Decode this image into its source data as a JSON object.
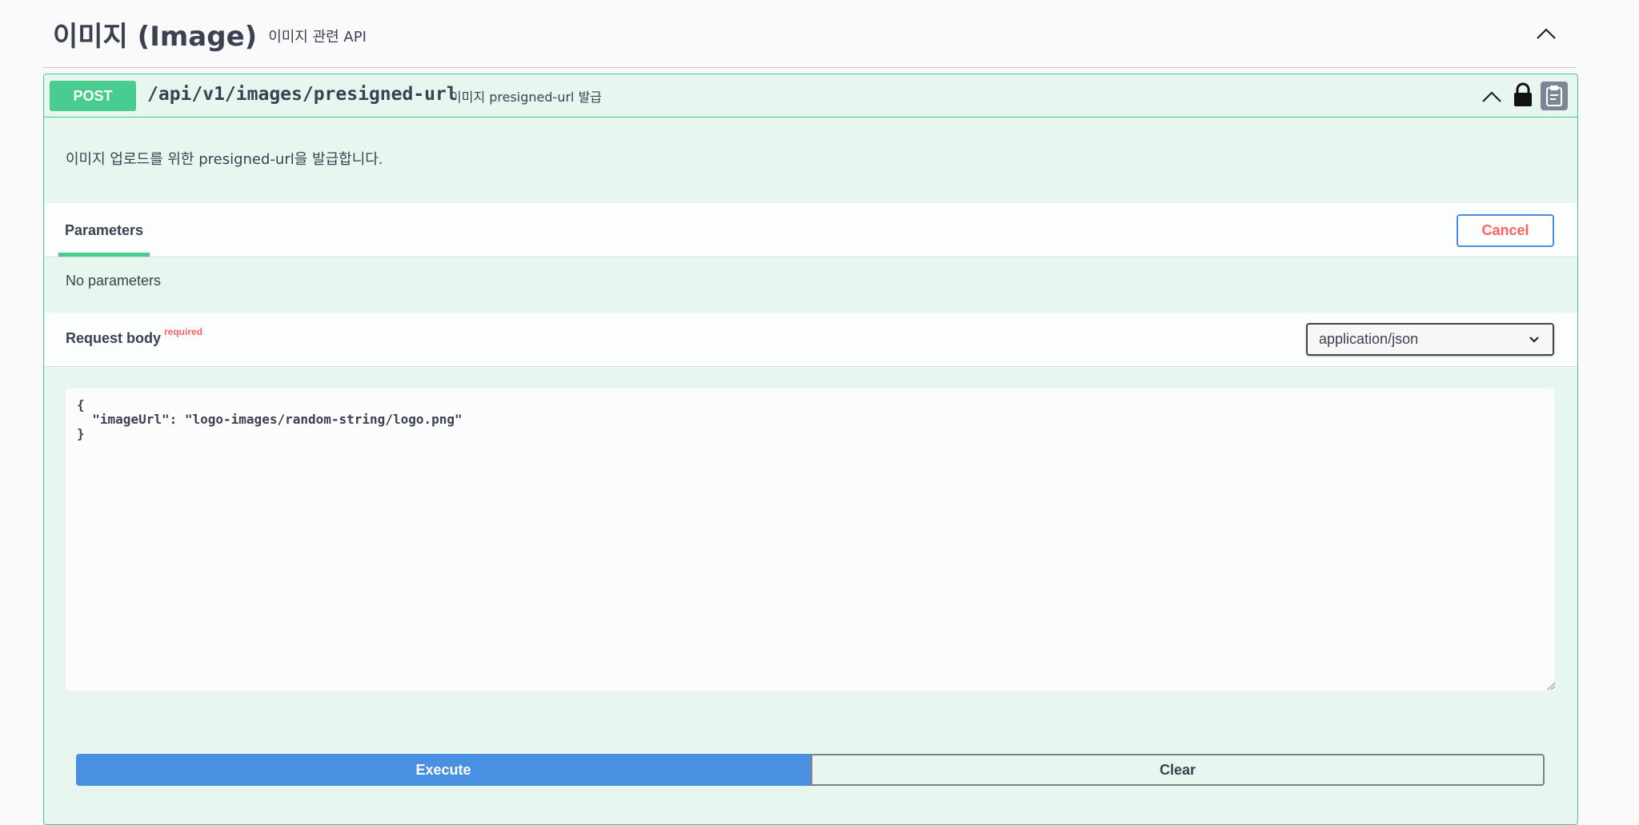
{
  "tag": {
    "title": "이미지 (Image)",
    "description": "이미지 관련 API"
  },
  "operation": {
    "method": "POST",
    "path": "/api/v1/images/presigned-url",
    "summary": "이미지 presigned-url 발급",
    "description": "이미지 업로드를 위한 presigned-url을 발급합니다."
  },
  "parameters": {
    "tab_label": "Parameters",
    "cancel_label": "Cancel",
    "empty_text": "No parameters"
  },
  "request_body": {
    "title": "Request body",
    "required_label": "required",
    "content_type": "application/json",
    "value": "{\n  \"imageUrl\": \"logo-images/random-string/logo.png\"\n}"
  },
  "actions": {
    "execute_label": "Execute",
    "clear_label": "Clear"
  },
  "colors": {
    "post_green": "#49cc90",
    "execute_blue": "#4990e2",
    "cancel_red": "#ff6060"
  },
  "icons": {
    "tag_toggle": "chevron-up-icon",
    "op_collapse": "chevron-up-icon",
    "lock": "lock-icon",
    "copy": "clipboard-icon",
    "select": "chevron-down-icon"
  }
}
